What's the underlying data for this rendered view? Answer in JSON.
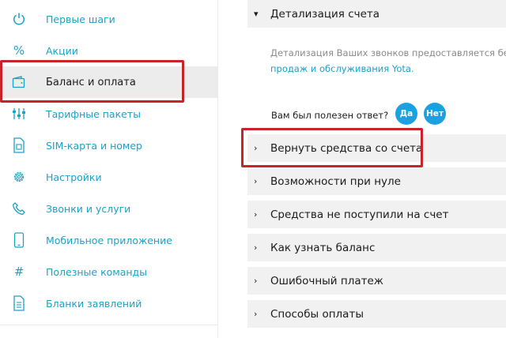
{
  "sidebar": {
    "items": [
      {
        "icon": "power-icon",
        "label": "Первые шаги",
        "active": false
      },
      {
        "icon": "percent-icon",
        "label": "Акции",
        "active": false
      },
      {
        "icon": "wallet-icon",
        "label": "Баланс и оплата",
        "active": true
      },
      {
        "icon": "sliders-icon",
        "label": "Тарифные пакеты",
        "active": false
      },
      {
        "icon": "sim-card-icon",
        "label": "SIM-карта и номер",
        "active": false
      },
      {
        "icon": "gear-icon",
        "label": "Настройки",
        "active": false
      },
      {
        "icon": "phone-icon",
        "label": "Звонки и услуги",
        "active": false
      },
      {
        "icon": "smartphone-icon",
        "label": "Мобильное приложение",
        "active": false
      },
      {
        "icon": "hash-icon",
        "label": "Полезные команды",
        "active": false
      },
      {
        "icon": "document-icon",
        "label": "Бланки заявлений",
        "active": false
      }
    ]
  },
  "main": {
    "expanded": {
      "label": "Детализация счета",
      "text": "Детализация Ваших звонков предоставляется беспла",
      "link": "продаж и обслуживания Yota",
      "link_suffix": "."
    },
    "feedback": {
      "question": "Вам был полезен ответ?",
      "yes": "Да",
      "no": "Нет"
    },
    "items": [
      {
        "label": "Вернуть средства со счета",
        "highlighted": true
      },
      {
        "label": "Возможности при нуле"
      },
      {
        "label": "Средства не поступили на счет"
      },
      {
        "label": "Как узнать баланс"
      },
      {
        "label": "Ошибочный платеж"
      },
      {
        "label": "Способы оплаты"
      }
    ]
  },
  "colors": {
    "accent": "#1ba1c7",
    "button": "#1ba1e2",
    "highlight_border": "#c8232a",
    "active_bg": "#ececec",
    "accordion_bg": "#f1f1f1"
  }
}
